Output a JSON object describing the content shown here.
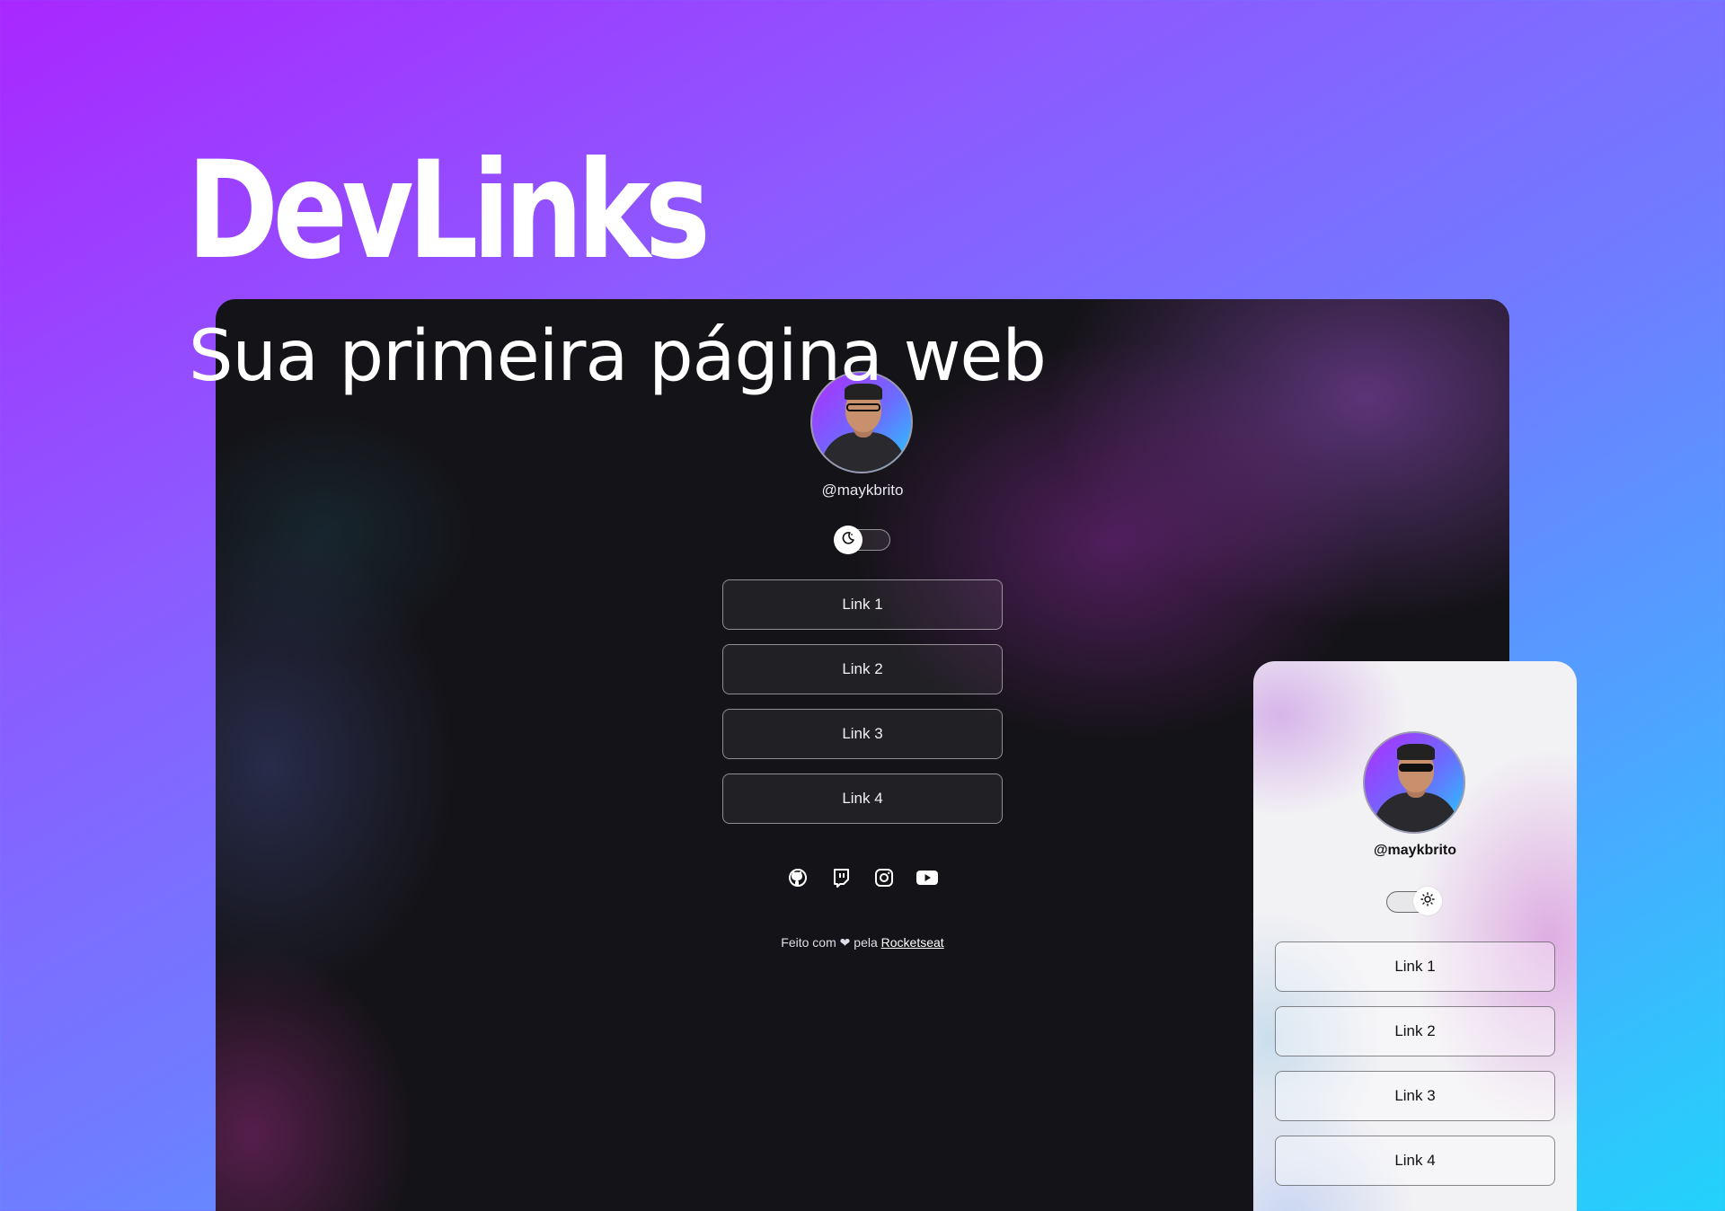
{
  "hero": {
    "title": "DevLinks",
    "subtitle": "Sua primeira página web"
  },
  "dark_preview": {
    "username": "@maykbrito",
    "toggle_icon": "moon-icon",
    "links": [
      "Link 1",
      "Link 2",
      "Link 3",
      "Link 4"
    ],
    "social_icons": [
      "github-icon",
      "twitch-icon",
      "instagram-icon",
      "youtube-icon"
    ],
    "footer": {
      "prefix": "Feito com",
      "heart": "❤",
      "middle": "pela",
      "link": "Rocketseat"
    }
  },
  "light_preview": {
    "username": "@maykbrito",
    "toggle_icon": "sun-icon",
    "links": [
      "Link 1",
      "Link 2",
      "Link 3",
      "Link 4"
    ]
  },
  "colors": {
    "background_gradient_start": "#a927ff",
    "background_gradient_end": "#22d3fb",
    "dark_surface": "#141317",
    "light_surface": "#f2f1f4"
  }
}
